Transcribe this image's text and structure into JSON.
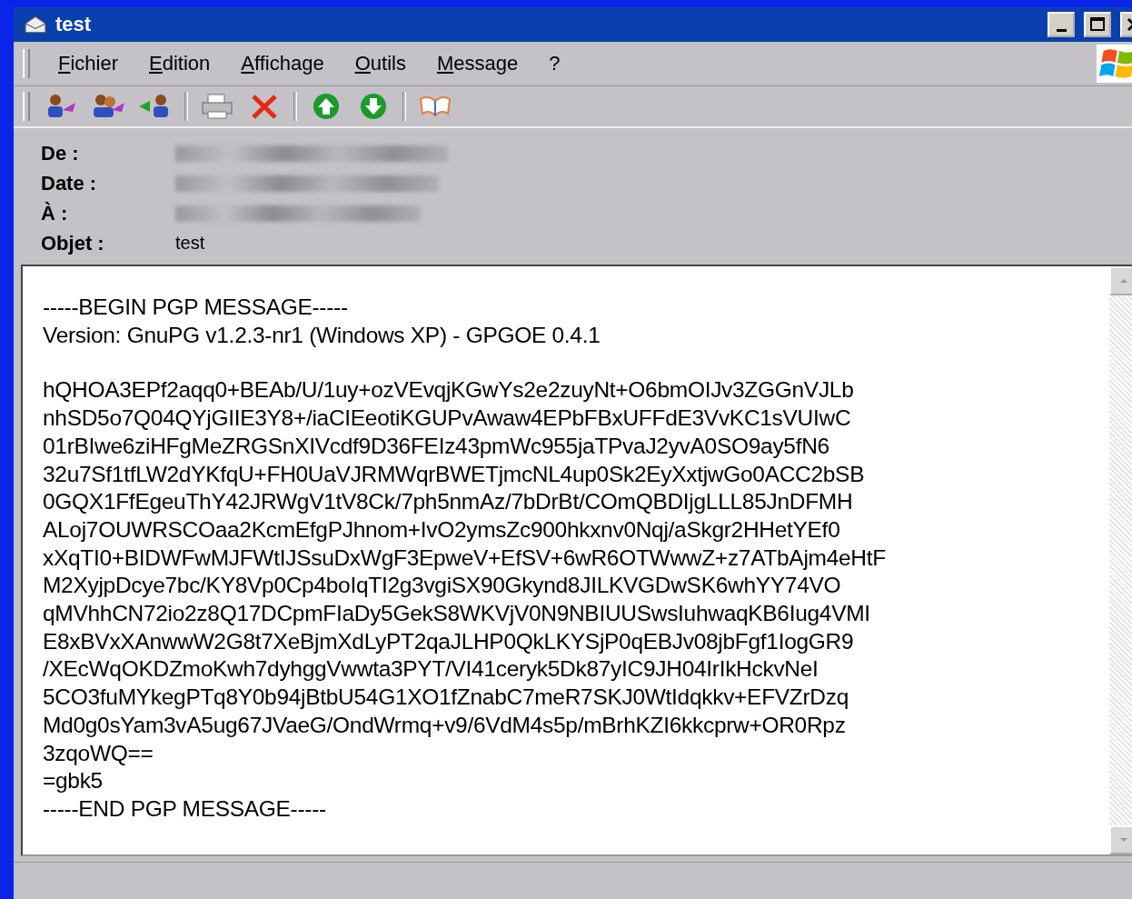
{
  "window": {
    "title": "test"
  },
  "menu": [
    {
      "label": "Fichier"
    },
    {
      "label": "Edition"
    },
    {
      "label": "Affichage"
    },
    {
      "label": "Outils"
    },
    {
      "label": "Message"
    },
    {
      "label": "?"
    }
  ],
  "header_fields": [
    {
      "label": "De :"
    },
    {
      "label": "Date :"
    },
    {
      "label": "À :"
    },
    {
      "label": "Objet :",
      "value": "test"
    }
  ],
  "message": {
    "header_lines": [
      "-----BEGIN PGP MESSAGE-----",
      "Version: GnuPG v1.2.3-nr1 (Windows XP) - GPGOE 0.4.1"
    ],
    "body_lines": [
      "hQHOA3EPf2aqq0+BEAb/U/1uy+ozVEvqjKGwYs2e2zuyNt+O6bmOIJv3ZGGnVJLb",
      "nhSD5o7Q04QYjGIIE3Y8+/iaCIEeotiKGUPvAwaw4EPbFBxUFFdE3VvKC1sVUIwC",
      "01rBIwe6ziHFgMeZRGSnXIVcdf9D36FEIz43pmWc955jaTPvaJ2yvA0SO9ay5fN6",
      "32u7Sf1tfLW2dYKfqU+FH0UaVJRMWqrBWETjmcNL4up0Sk2EyXxtjwGo0ACC2bSB",
      "0GQX1FfEgeuThY42JRWgV1tV8Ck/7ph5nmAz/7bDrBt/COmQBDIjgLLL85JnDFMH",
      "ALoj7OUWRSCOaa2KcmEfgPJhnom+IvO2ymsZc900hkxnv0Nqj/aSkgr2HHetYEf0",
      "xXqTI0+BIDWFwMJFWtIJSsuDxWgF3EpweV+EfSV+6wR6OTWwwZ+z7ATbAjm4eHtF",
      "M2XyjpDcye7bc/KY8Vp0Cp4boIqTI2g3vgiSX90Gkynd8JILKVGDwSK6whYY74VO",
      "qMVhhCN72io2z8Q17DCpmFIaDy5GekS8WKVjV0N9NBIUUSwsIuhwaqKB6Iug4VMI",
      "E8xBVxXAnwwW2G8t7XeBjmXdLyPT2qaJLHP0QkLKYSjP0qEBJv08jbFgf1IogGR9",
      "/XEcWqOKDZmoKwh7dyhggVwwta3PYT/VI41ceryk5Dk87yIC9JH04IrIkHckvNeI",
      "5CO3fuMYkegPTq8Y0b94jBtbU54G1XO1fZnabC7meR7SKJ0WtIdqkkv+EFVZrDzq",
      "Md0g0sYam3vA5ug67JVaeG/OndWrmq+v9/6VdM4s5p/mBrhKZI6kkcprw+OR0Rpz",
      "3zqoWQ==",
      "=gbk5",
      "-----END PGP MESSAGE-----"
    ]
  }
}
